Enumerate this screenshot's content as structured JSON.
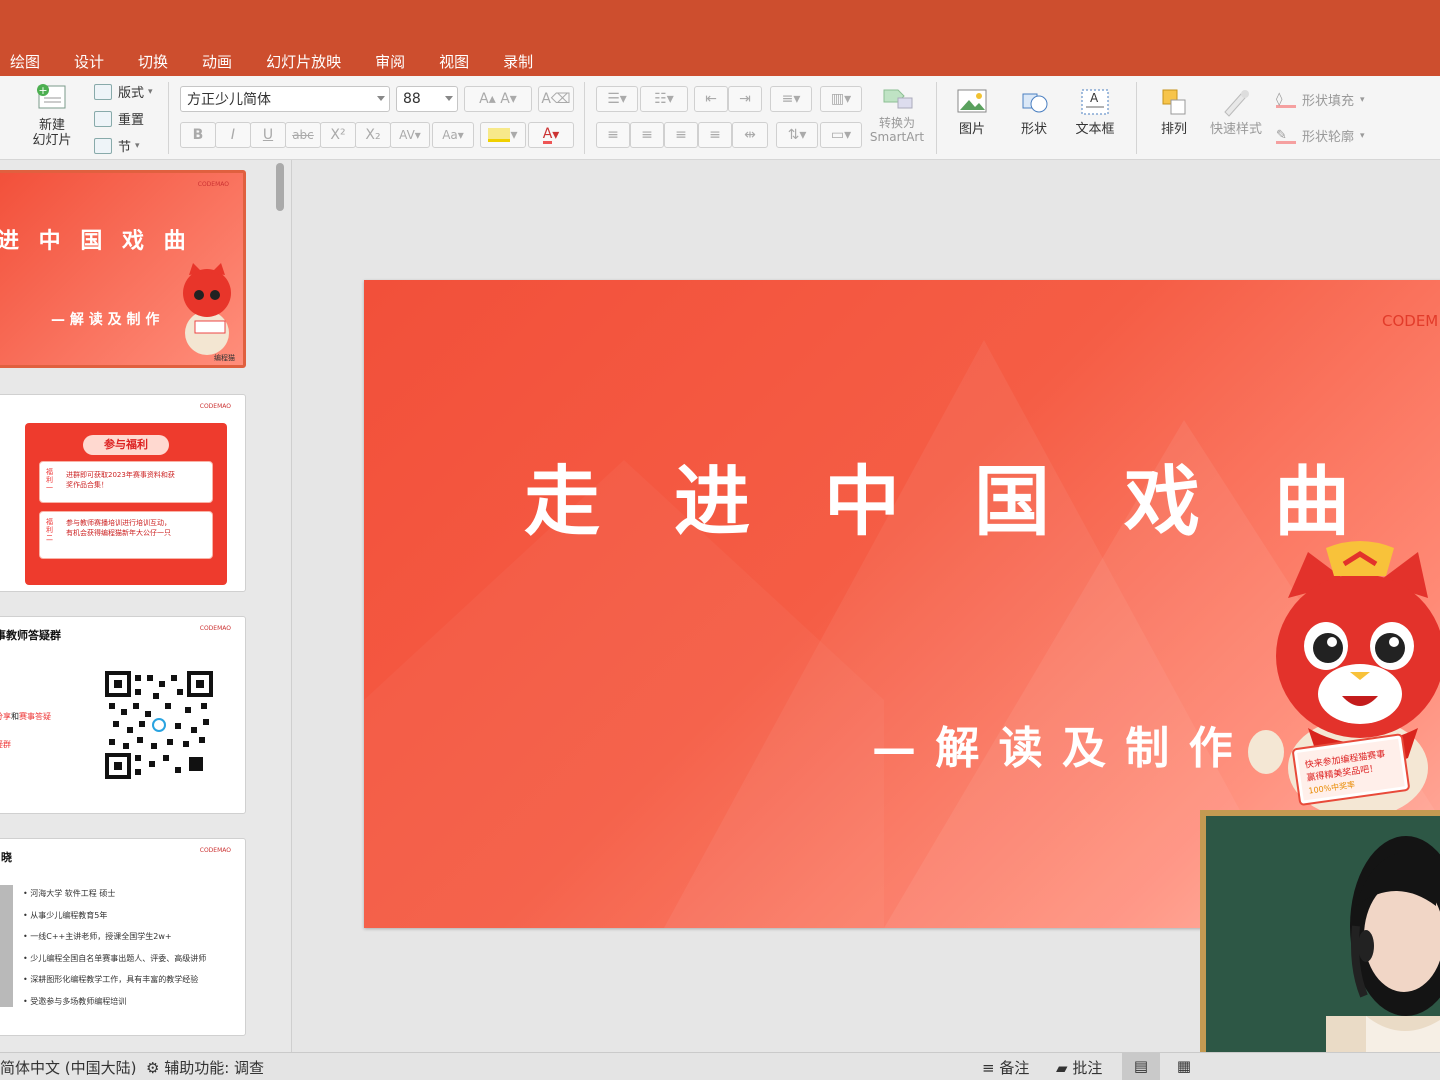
{
  "tabs": [
    "绘图",
    "设计",
    "切换",
    "动画",
    "幻灯片放映",
    "审阅",
    "视图",
    "录制"
  ],
  "ribbon": {
    "new_slide": "新建\n幻灯片",
    "layout": "版式",
    "reset": "重置",
    "section": "节",
    "font_name": "方正少儿简体",
    "font_size": "88",
    "bold": "B",
    "italic": "I",
    "underline": "U",
    "strike": "abc",
    "convert_smartart": "转换为\nSmartArt",
    "picture": "图片",
    "shape": "形状",
    "textbox": "文本框",
    "arrange": "排列",
    "quick_styles": "快速样式",
    "shape_fill": "形状填充",
    "shape_outline": "形状轮廓"
  },
  "thumbnails": {
    "t1": {
      "logo": "CODEMAO",
      "title": "进 中 国 戏 曲",
      "subtitle": "— 解 读 及 制 作",
      "brand": "编程猫"
    },
    "t2": {
      "logo": "CODEMAO",
      "banner": "参与福利",
      "b1_tag": "福利一",
      "b1_text": "进群即可获取2023年赛事资料和获奖作品合集！",
      "b2_tag": "福利二",
      "b2_text": "参与教师赛播培训进行培训互动，有机会获得编程猫新年大公仔一只"
    },
    "t3": {
      "logo": "CODEMAO",
      "title": "事教师答疑群",
      "line1_a": "分享",
      "line1_b": "和",
      "line1_c": "赛事答疑",
      "line2": "疑群"
    },
    "t4": {
      "logo": "CODEMAO",
      "name": "晓",
      "bullets": [
        "河海大学 软件工程 硕士",
        "从事少儿编程教育5年",
        "一线C++主讲老师，授课全国学生2w+",
        "少儿编程全国自名单赛事出题人、评委、高级讲师",
        "深耕图形化编程教学工作，具有丰富的教学经验",
        "受邀参与多场教师编程培训"
      ]
    }
  },
  "slide": {
    "logo": "CODEM",
    "title_chars": [
      "走",
      "进",
      "中",
      "国",
      "戏",
      "曲"
    ],
    "subtitle": "— 解 读 及 制 作",
    "card_line1": "快来参加编程猫赛事",
    "card_line2": "赢得精美奖品吧！",
    "card_line3": "100%中奖率"
  },
  "status": {
    "language": "简体中文 (中国大陆)",
    "accessibility": "辅助功能: 调查",
    "notes": "备注",
    "comments": "批注"
  },
  "colors": {
    "accent": "#cd4e2e",
    "slide_red": "#f2503a"
  }
}
